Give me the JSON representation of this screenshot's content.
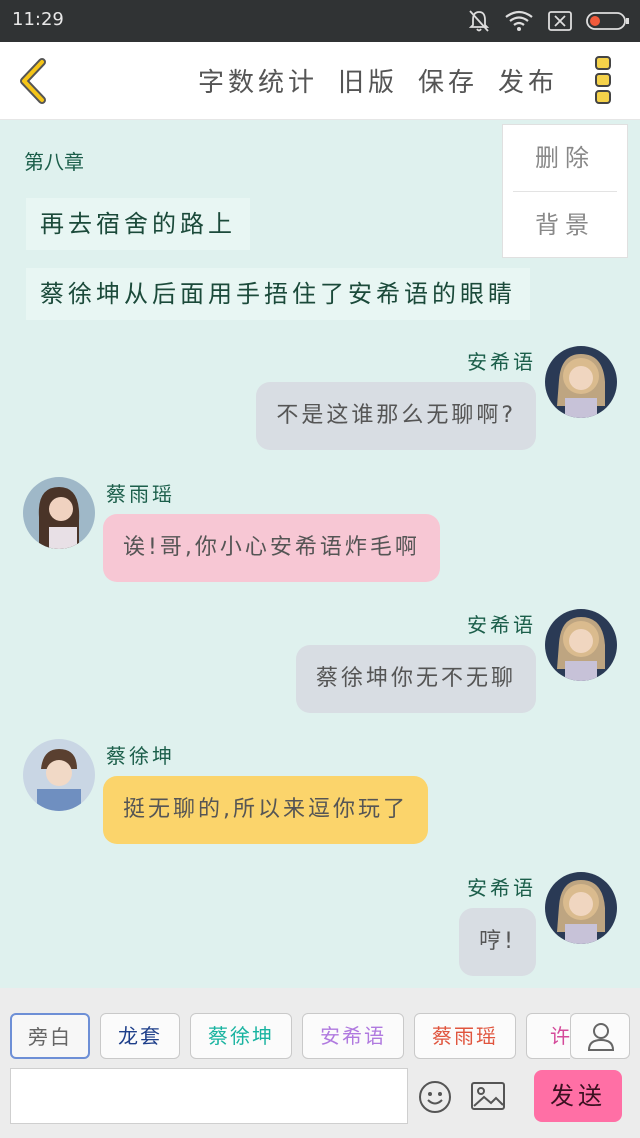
{
  "status": {
    "time": "11:29"
  },
  "topbar": {
    "actions": [
      "字数统计",
      "旧版",
      "保存",
      "发布"
    ]
  },
  "chat": {
    "chapter": "第八章",
    "narration": [
      "再去宿舍的路上",
      "蔡徐坤从后面用手捂住了安希语的眼睛"
    ],
    "context_menu": [
      "删除",
      "背景"
    ],
    "messages": [
      {
        "name": "安希语",
        "text": "不是这谁那么无聊啊?"
      },
      {
        "name": "蔡雨瑶",
        "text": "诶!哥,你小心安希语炸毛啊"
      },
      {
        "name": "安希语",
        "text": "蔡徐坤你无不无聊"
      },
      {
        "name": "蔡徐坤",
        "text": "挺无聊的,所以来逗你玩了"
      },
      {
        "name": "安希语",
        "text": "哼!"
      }
    ]
  },
  "bottom": {
    "chips": [
      {
        "label": "旁白",
        "color": "#666666"
      },
      {
        "label": "龙套",
        "color": "#1e3f8a"
      },
      {
        "label": "蔡徐坤",
        "color": "#19b3a0"
      },
      {
        "label": "安希语",
        "color": "#b07adf"
      },
      {
        "label": "蔡雨瑶",
        "color": "#e0553e"
      },
      {
        "label": "许",
        "color": "#d44a9a"
      }
    ],
    "input_value": "",
    "send_label": "发送"
  },
  "colors": {
    "accent": "#ff6fa5",
    "chat_bg": "#dff1ee",
    "back_arrow": "#f5c518"
  }
}
